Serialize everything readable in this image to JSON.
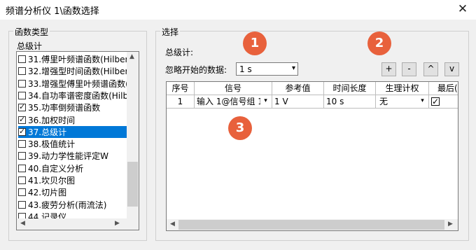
{
  "window": {
    "title": "频谱分析仪 1\\函数选择"
  },
  "left_panel": {
    "group_title": "函数类型",
    "section_label": "总级计",
    "items": [
      {
        "label": "31.傅里叶频谱函数(Hilbert)",
        "checked": false,
        "selected": false
      },
      {
        "label": "32.增强型时间函数(Hilbert)",
        "checked": false,
        "selected": false
      },
      {
        "label": "33.增强型傅里叶频谱函数(",
        "checked": false,
        "selected": false
      },
      {
        "label": "34.自功率谱密度函数(Hilbe",
        "checked": false,
        "selected": false
      },
      {
        "label": "35.功率倒频谱函数",
        "checked": true,
        "selected": false
      },
      {
        "label": "36.加权时间",
        "checked": true,
        "selected": false
      },
      {
        "label": "37.总级计",
        "checked": true,
        "selected": true
      },
      {
        "label": "38.极值统计",
        "checked": false,
        "selected": false
      },
      {
        "label": "39.动力学性能评定W",
        "checked": false,
        "selected": false
      },
      {
        "label": "40.自定义分析",
        "checked": false,
        "selected": false
      },
      {
        "label": "41.坎贝尔图",
        "checked": false,
        "selected": false
      },
      {
        "label": "42.切片图",
        "checked": false,
        "selected": false
      },
      {
        "label": "43.疲劳分析(雨流法)",
        "checked": false,
        "selected": false
      },
      {
        "label": "44.记录仪",
        "checked": false,
        "selected": false
      }
    ]
  },
  "right_panel": {
    "group_title": "选择",
    "heading": "总级计:",
    "ignore_label": "忽略开始的数据:",
    "ignore_value": "1 s",
    "buttons": {
      "add": "+",
      "remove": "-",
      "up": "^",
      "down": "v"
    },
    "table": {
      "headers": [
        "序号",
        "信号",
        "参考值",
        "时间长度",
        "生理计权",
        "最后(。"
      ],
      "rows": [
        {
          "index": "1",
          "signal": "输入 1@信号组 1",
          "reference": "1 V",
          "duration": "10 s",
          "weighting": "无",
          "last_checked": true
        }
      ]
    }
  },
  "annotations": {
    "badge1": "1",
    "badge2": "2",
    "badge3": "3"
  },
  "colors": {
    "selection": "#0078d7",
    "badge": "#e8613c"
  }
}
